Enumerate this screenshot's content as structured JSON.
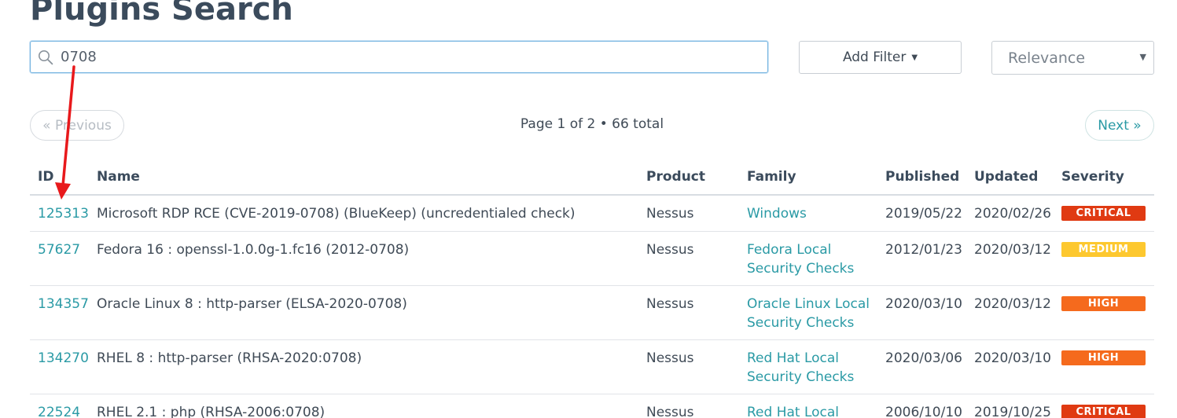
{
  "page": {
    "title": "Plugins Search"
  },
  "search": {
    "value": "0708",
    "placeholder": ""
  },
  "filters": {
    "add_filter_label": "Add Filter",
    "sort_selected": "Relevance"
  },
  "pagination": {
    "previous_label": "« Previous",
    "next_label": "Next »",
    "info": "Page 1 of 2 • 66 total"
  },
  "table": {
    "columns": {
      "id": "ID",
      "name": "Name",
      "product": "Product",
      "family": "Family",
      "published": "Published",
      "updated": "Updated",
      "severity": "Severity"
    },
    "rows": [
      {
        "id": "125313",
        "name": "Microsoft RDP RCE (CVE-2019-0708) (BlueKeep) (uncredentialed check)",
        "product": "Nessus",
        "family": "Windows",
        "published": "2019/05/22",
        "updated": "2020/02/26",
        "severity": "CRITICAL"
      },
      {
        "id": "57627",
        "name": "Fedora 16 : openssl-1.0.0g-1.fc16 (2012-0708)",
        "product": "Nessus",
        "family": "Fedora Local Security Checks",
        "published": "2012/01/23",
        "updated": "2020/03/12",
        "severity": "MEDIUM"
      },
      {
        "id": "134357",
        "name": "Oracle Linux 8 : http-parser (ELSA-2020-0708)",
        "product": "Nessus",
        "family": "Oracle Linux Local Security Checks",
        "published": "2020/03/10",
        "updated": "2020/03/12",
        "severity": "HIGH"
      },
      {
        "id": "134270",
        "name": "RHEL 8 : http-parser (RHSA-2020:0708)",
        "product": "Nessus",
        "family": "Red Hat Local Security Checks",
        "published": "2020/03/06",
        "updated": "2020/03/10",
        "severity": "HIGH"
      },
      {
        "id": "22524",
        "name": "RHEL 2.1 : php (RHSA-2006:0708)",
        "product": "Nessus",
        "family": "Red Hat Local",
        "published": "2006/10/10",
        "updated": "2019/10/25",
        "severity": "CRITICAL"
      }
    ]
  },
  "colors": {
    "link": "#2a9aa5",
    "critical": "#e03a12",
    "high": "#f56a1d",
    "medium": "#fdc82f",
    "annotation_arrow": "#e8191c"
  },
  "icons": {
    "search": "search-icon",
    "caret": "caret-down-icon",
    "select_arrow": "select-arrow-icon"
  }
}
